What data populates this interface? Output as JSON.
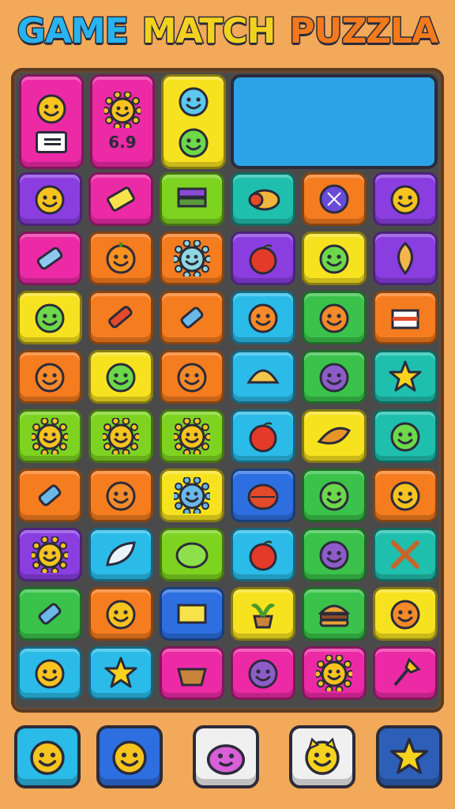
{
  "title": {
    "word1": "GAME",
    "word2": "MATCH",
    "word3": "PUZZLA"
  },
  "hud": {
    "meter_text": "6.9"
  },
  "colors": {
    "magenta": "#ec2aa6",
    "purple": "#8a3ee0",
    "lime": "#7ed321",
    "teal": "#1fbfae",
    "orange": "#f57c1f",
    "yellow": "#f7e21f",
    "cyan": "#2bbbe8",
    "green": "#3ac24a",
    "blue": "#2d6fe0",
    "panel": "#2ca3e8"
  },
  "grid": [
    [
      [
        "purple",
        "icon-smiley-gold"
      ],
      [
        "magenta",
        "icon-ticket"
      ],
      [
        "lime",
        "icon-books"
      ],
      [
        "teal",
        "icon-food-pie"
      ],
      [
        "orange",
        "icon-crystal-ball"
      ],
      [
        "purple",
        "icon-smiley-gold"
      ]
    ],
    [
      [
        "magenta",
        "icon-tube"
      ],
      [
        "orange",
        "icon-pumpkin"
      ],
      [
        "orange",
        "icon-virus-blob"
      ],
      [
        "purple",
        "icon-apple"
      ],
      [
        "yellow",
        "icon-smiley-green"
      ],
      [
        "purple",
        "icon-leaf"
      ]
    ],
    [
      [
        "yellow",
        "icon-smiley-green"
      ],
      [
        "orange",
        "icon-robot-arm"
      ],
      [
        "orange",
        "icon-spray"
      ],
      [
        "cyan",
        "icon-smiley-orange"
      ],
      [
        "green",
        "icon-smiley-orange"
      ],
      [
        "orange",
        "icon-cake"
      ]
    ],
    [
      [
        "orange",
        "icon-smiley-orange"
      ],
      [
        "yellow",
        "icon-smiley-green"
      ],
      [
        "orange",
        "icon-smiley-orange"
      ],
      [
        "cyan",
        "icon-taco"
      ],
      [
        "green",
        "icon-smiley-purple"
      ],
      [
        "teal",
        "icon-star"
      ]
    ],
    [
      [
        "lime",
        "icon-sun-smiley"
      ],
      [
        "lime",
        "icon-sun-smiley"
      ],
      [
        "lime",
        "icon-sun-smiley"
      ],
      [
        "cyan",
        "icon-apple"
      ],
      [
        "yellow",
        "icon-croissant"
      ],
      [
        "teal",
        "icon-smiley-green"
      ]
    ],
    [
      [
        "orange",
        "icon-spray"
      ],
      [
        "orange",
        "icon-smiley-orange"
      ],
      [
        "yellow",
        "icon-blob-blue"
      ],
      [
        "blue",
        "icon-tomato"
      ],
      [
        "green",
        "icon-smiley-green"
      ],
      [
        "orange",
        "icon-smiley-gold"
      ]
    ],
    [
      [
        "purple",
        "icon-sun-smiley"
      ],
      [
        "cyan",
        "icon-feather"
      ],
      [
        "lime",
        "icon-lemon"
      ],
      [
        "cyan",
        "icon-apple"
      ],
      [
        "green",
        "icon-smiley-purple"
      ],
      [
        "teal",
        "icon-chopsticks"
      ]
    ],
    [
      [
        "green",
        "icon-spray"
      ],
      [
        "orange",
        "icon-smiley-gold"
      ],
      [
        "blue",
        "icon-book"
      ],
      [
        "yellow",
        "icon-plant"
      ],
      [
        "green",
        "icon-burger"
      ],
      [
        "yellow",
        "icon-smiley-orange"
      ]
    ],
    [
      [
        "cyan",
        "icon-smiley-gold"
      ],
      [
        "cyan",
        "icon-star"
      ],
      [
        "magenta",
        "icon-basket"
      ],
      [
        "magenta",
        "icon-smiley-purple"
      ],
      [
        "magenta",
        "icon-sun-smiley"
      ],
      [
        "magenta",
        "icon-paint-brush"
      ]
    ]
  ],
  "footer": [
    [
      "#2bbbe8",
      "icon-smiley-gold"
    ],
    [
      "#2d6fe0",
      "icon-smiley-gold"
    ],
    [
      "#f0f0f0",
      "icon-blob-pink"
    ],
    [
      "#f0f0f0",
      "icon-cat-smiley"
    ],
    [
      "#2d5fb8",
      "icon-star"
    ]
  ]
}
